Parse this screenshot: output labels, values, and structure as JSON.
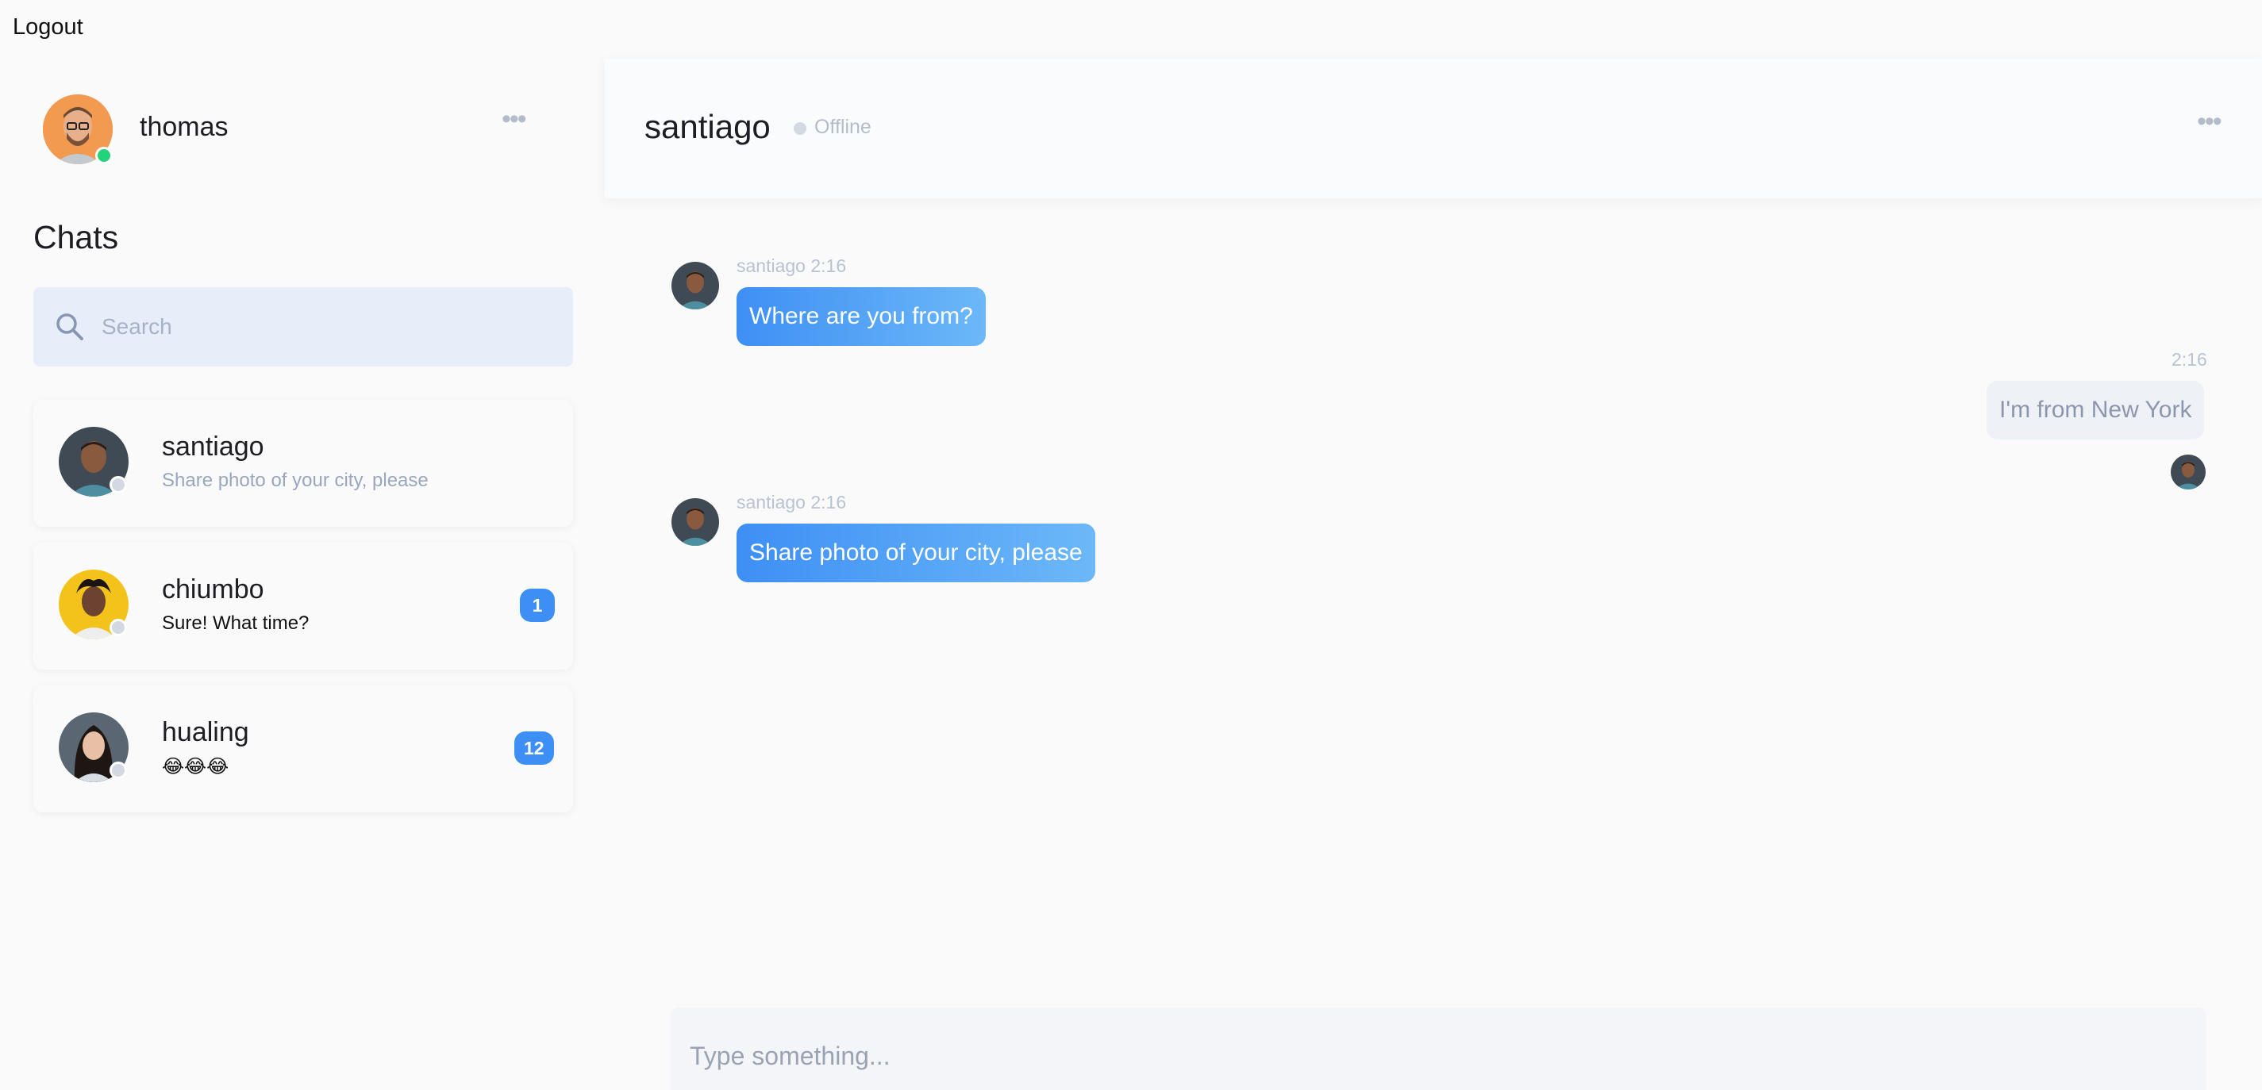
{
  "header": {
    "logout_label": "Logout"
  },
  "current_user": {
    "name": "thomas",
    "status": "online"
  },
  "sidebar": {
    "title": "Chats",
    "search": {
      "placeholder": "Search",
      "value": ""
    },
    "chats": [
      {
        "name": "santiago",
        "preview": "Share photo of your city, please",
        "status": "offline",
        "unread": ""
      },
      {
        "name": "chiumbo",
        "preview": "Sure! What time?",
        "status": "offline",
        "unread": "1"
      },
      {
        "name": "hualing",
        "preview": "😂😂😂",
        "status": "offline",
        "unread": "12"
      }
    ]
  },
  "conversation": {
    "title": "santiago",
    "status": "Offline",
    "messages": [
      {
        "direction": "in",
        "meta": "santiago 2:16",
        "text": "Where are you from?"
      },
      {
        "direction": "out",
        "meta": "2:16",
        "text": "I'm from New York"
      },
      {
        "direction": "in",
        "meta": "santiago 2:16",
        "text": "Share photo of your city, please"
      }
    ],
    "composer_placeholder": "Type something..."
  },
  "colors": {
    "accent": "#3e8ff5",
    "online": "#22d37a",
    "offline": "#d3d8e3",
    "background": "#fafafa"
  }
}
